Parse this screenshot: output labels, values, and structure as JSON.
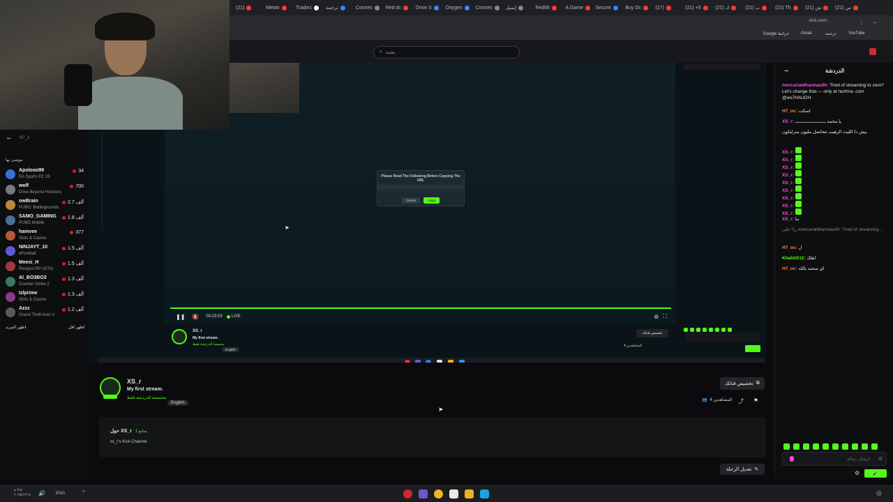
{
  "browser": {
    "tabs": [
      {
        "label": "(21)",
        "color": "#ff3b30"
      },
      {
        "label": "Metatr",
        "color": "#ff3b30"
      },
      {
        "label": "Tradinc",
        "color": "#ffffff"
      },
      {
        "label": "ترجمة",
        "color": "#4285f4"
      },
      {
        "label": "Connec",
        "color": "#888888"
      },
      {
        "label": "Red dc",
        "color": "#ff3b30"
      },
      {
        "label": "Drive S",
        "color": "#4285f4"
      },
      {
        "label": "Oxygen",
        "color": "#4285f4"
      },
      {
        "label": "Connec",
        "color": "#888888"
      },
      {
        "label": "إيميل",
        "color": "#888888"
      },
      {
        "label": "RedMi",
        "color": "#ff3b30"
      },
      {
        "label": "A Game",
        "color": "#ff3b30"
      },
      {
        "label": "Secure",
        "color": "#3b82f6"
      },
      {
        "label": "Buy Dc",
        "color": "#ff3b30"
      },
      {
        "label": "(17)",
        "color": "#ff3b30"
      },
      {
        "label": "(21) +5",
        "color": "#ff3b30"
      },
      {
        "label": "(21) ك",
        "color": "#ff3b30"
      },
      {
        "label": "(21) ب",
        "color": "#ff3b30"
      },
      {
        "label": "(21) Th",
        "color": "#ff3b30"
      },
      {
        "label": "(21) ش",
        "color": "#ff3b30"
      },
      {
        "label": "(21) س",
        "color": "#ff3b30"
      }
    ],
    "url": "kick.com/...",
    "bookmarks": [
      "Google خرائط",
      "Gmail",
      "ترجمة",
      "YouTube"
    ]
  },
  "header": {
    "search_placeholder": "بحث"
  },
  "sidebar": {
    "user": "H7_o",
    "section_title": "موصى بها",
    "channels": [
      {
        "name": "Apolooo99",
        "game": "EA Sports FC 25",
        "viewers": "34",
        "color": "#3d6fd6"
      },
      {
        "name": "wolf",
        "game": "Drive Beyond Horizons",
        "viewers": "700",
        "color": "#7a7a7a"
      },
      {
        "name": "owBrain",
        "game": "PUBG: Battlegrounds",
        "viewers": "2.7 ألف",
        "color": "#b58b3a"
      },
      {
        "name": "SAMO_GAMING",
        "game": "PUBG Mobile",
        "viewers": "1.8 ألف",
        "color": "#4a6f9a"
      },
      {
        "name": "hamvee",
        "game": "Slots & Casino",
        "viewers": "377",
        "color": "#b8563a"
      },
      {
        "name": "NINJAYT_10",
        "game": "eFootball",
        "viewers": "1.5 ألف",
        "color": "#5b5bd6"
      },
      {
        "name": "Meesi_H",
        "game": "Respect RP (GTA)",
        "viewers": "1.5 ألف",
        "color": "#9b3a3a"
      },
      {
        "name": "Al_BO3BO3",
        "game": "Counter-Strike 2",
        "viewers": "1.3 ألف",
        "color": "#3a7a5a"
      },
      {
        "name": "Izlprime",
        "game": "Slots & Casino",
        "viewers": "1.3 ألف",
        "color": "#8a3a8a"
      },
      {
        "name": "Azzz",
        "game": "Grand Theft Auto V",
        "viewers": "1.2 ألف",
        "color": "#5a5a5a"
      }
    ],
    "show_more": "اظهر المزيد",
    "show_less": "اظهر اقل"
  },
  "player": {
    "time": "00:23:53",
    "live": "LIVE",
    "dialog_title": "Please Read The Following Before Copying The URL",
    "dialog_cancel": "Cancel",
    "dialog_copy": "Copy"
  },
  "mini_info": {
    "channel": "XS_r",
    "title": "My first stream.",
    "category": "محمصة الدردشة فقط",
    "language": "English",
    "customize": "تخصيص قناتك",
    "followers": "4 المشاهدين"
  },
  "stream": {
    "channel": "XS_r",
    "title": "My first stream.",
    "category": "مخصصة للدردشة فقط",
    "language": "English",
    "customize_button": "تخصيص قناتك",
    "viewers_label": "4 المشاهدين",
    "about_title": "حول XS_r",
    "about_followers": "1 متابع",
    "about_description": "xs_r's Kick Channel",
    "edit_button": "تعديل الرحلة"
  },
  "chat": {
    "title": "الدردشة",
    "messages": [
      {
        "user": "mercurialdharmau0h:",
        "text": "Tired of streaming to zero? Let's change that — only at nezhna .com @ws7HAUDH",
        "color": "#ff4fd8"
      },
      {
        "user": "H7_oc:",
        "text": "اسكت",
        "color": "#ff8a3d"
      },
      {
        "user": "XS_r:",
        "text": "يا محمد ـــــــــــــــــــــــ",
        "color": "#ff4fd8"
      },
      {
        "user": "",
        "text": "يبش دا الليث الرهيب تتحاضل مليون مترليكون",
        "color": "#e8e8e8"
      },
      {
        "user": "XS_r:",
        "text": "",
        "color": "#ff4fd8"
      },
      {
        "user": "XS_r:",
        "text": "",
        "color": "#ff4fd8"
      },
      {
        "user": "XS_r:",
        "text": "",
        "color": "#ff4fd8"
      },
      {
        "user": "XS_r:",
        "text": "",
        "color": "#ff4fd8"
      },
      {
        "user": "XS_r:",
        "text": "",
        "color": "#ff4fd8"
      },
      {
        "user": "XS_r:",
        "text": "",
        "color": "#ff4fd8"
      },
      {
        "user": "XS_r:",
        "text": "",
        "color": "#ff4fd8"
      },
      {
        "user": "XS_r:",
        "text": "",
        "color": "#ff4fd8"
      },
      {
        "user": "XS_r:",
        "text": "",
        "color": "#ff4fd8"
      },
      {
        "user": "XS_r:",
        "text": "تبا",
        "color": "#ff4fd8"
      },
      {
        "user": "",
        "text": "ردًا على mercurialdharmau0h: Tired of streaming...",
        "color": "#8a8a8a"
      },
      {
        "user": "H7_oc:",
        "text": "ل",
        "color": "#ff8a3d"
      },
      {
        "user": "KhalidX12:",
        "text": "اهلك",
        "color": "#53fc18"
      },
      {
        "user": "H7_oc:",
        "text": "اي سحبه يالله",
        "color": "#ff8a3d"
      }
    ],
    "input_placeholder": "إرسال رسالة",
    "send_label": "دردشة"
  },
  "taskbar": {
    "lang": "ENG",
    "time": "٣:٥٠ م",
    "date": "٢٠٢٥/١٢/١٤"
  },
  "colors": {
    "accent": "#53fc18",
    "bg": "#0b0b0d"
  }
}
